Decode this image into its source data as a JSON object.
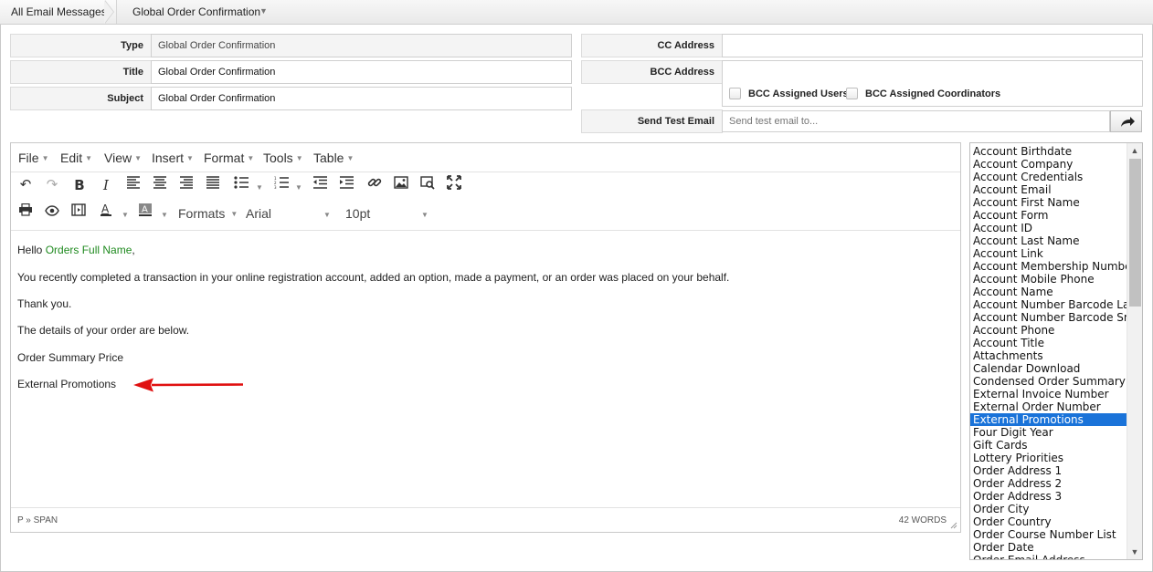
{
  "breadcrumb": {
    "root": "All Email Messages",
    "current": "Global Order Confirmation",
    "dropdown_icon": "caret-down"
  },
  "form": {
    "type_label": "Type",
    "type_value": "Global Order Confirmation",
    "title_label": "Title",
    "title_value": "Global Order Confirmation",
    "subject_label": "Subject",
    "subject_value": "Global Order Confirmation",
    "cc_label": "CC Address",
    "cc_value": "",
    "bcc_label": "BCC Address",
    "bcc_value": "",
    "bcc_assigned_users": "BCC Assigned Users",
    "bcc_assigned_coordinators": "BCC Assigned Coordinators",
    "send_test_label": "Send Test Email",
    "send_test_placeholder": "Send test email to...",
    "send_icon": "share-arrow"
  },
  "editor": {
    "menus": [
      "File",
      "Edit",
      "View",
      "Insert",
      "Format",
      "Tools",
      "Table"
    ],
    "formats_label": "Formats",
    "font_family": "Arial",
    "font_size": "10pt",
    "content": {
      "hello": "Hello",
      "name_field": "Orders Full Name",
      "comma": ",",
      "line1": "You recently completed a transaction in your online registration account, added an option, made a payment, or an order was placed on your behalf.",
      "line2": "Thank you.",
      "line3": "The details of your order are below.",
      "field1": "Order Summary Price",
      "field2": "External Promotions"
    },
    "status_path": "P » SPAN",
    "word_count": "42 WORDS"
  },
  "merge_fields": {
    "selected": "External Promotions",
    "items": [
      "Account Birthdate",
      "Account Company",
      "Account Credentials",
      "Account Email",
      "Account First Name",
      "Account Form",
      "Account ID",
      "Account Last Name",
      "Account Link",
      "Account Membership Number",
      "Account Mobile Phone",
      "Account Name",
      "Account Number Barcode Large",
      "Account Number Barcode Small",
      "Account Phone",
      "Account Title",
      "Attachments",
      "Calendar Download",
      "Condensed Order Summary",
      "External Invoice Number",
      "External Order Number",
      "External Promotions",
      "Four Digit Year",
      "Gift Cards",
      "Lottery Priorities",
      "Order Address 1",
      "Order Address 2",
      "Order Address 3",
      "Order City",
      "Order Country",
      "Order Course Number List",
      "Order Date",
      "Order Email Address"
    ]
  },
  "colors": {
    "merge_field_green": "#1f8a1f",
    "selection_blue": "#1a73d9",
    "annotation_red": "#e01010"
  }
}
